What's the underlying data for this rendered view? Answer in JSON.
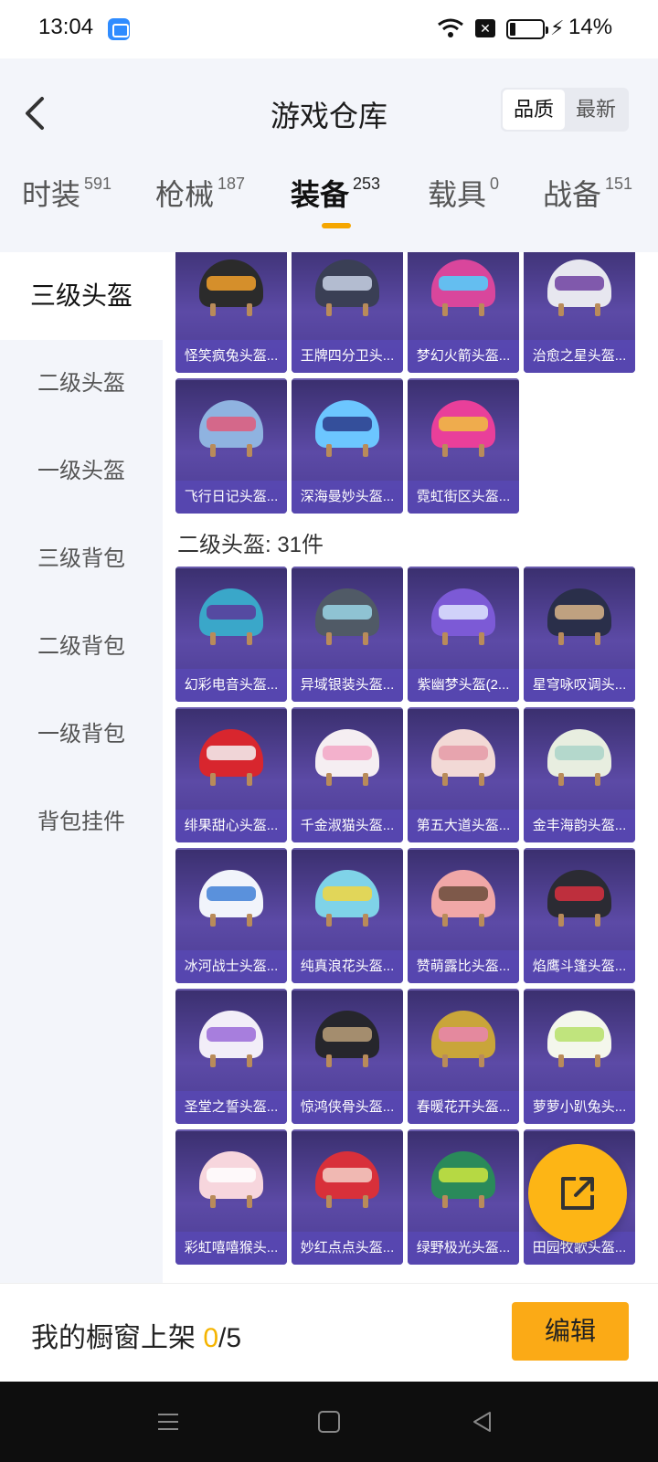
{
  "status_bar": {
    "time": "13:04",
    "battery": "14%"
  },
  "header": {
    "title": "游戏仓库",
    "sort_options": [
      "品质",
      "最新"
    ],
    "sort_active": "品质"
  },
  "categories": [
    {
      "label": "时装",
      "count": "591"
    },
    {
      "label": "枪械",
      "count": "187"
    },
    {
      "label": "装备",
      "count": "253"
    },
    {
      "label": "载具",
      "count": "0"
    },
    {
      "label": "战备",
      "count": "151"
    }
  ],
  "sidebar": [
    "三级头盔",
    "二级头盔",
    "一级头盔",
    "三级背包",
    "二级背包",
    "一级背包",
    "背包挂件"
  ],
  "level3_items": [
    "怪笑疯兔头盔...",
    "王牌四分卫头...",
    "梦幻火箭头盔...",
    "治愈之星头盔...",
    "飞行日记头盔...",
    "深海曼妙头盔...",
    "霓虹街区头盔..."
  ],
  "section_level2": "二级头盔: 31件",
  "level2_items": [
    "幻彩电音头盔...",
    "异域银装头盔...",
    "紫幽梦头盔(2...",
    "星穹咏叹调头...",
    "绯果甜心头盔...",
    "千金淑猫头盔...",
    "第五大道头盔...",
    "金丰海韵头盔...",
    "冰河战士头盔...",
    "纯真浪花头盔...",
    "赞萌露比头盔...",
    "焰鹰斗篷头盔...",
    "圣堂之誓头盔...",
    "惊鸿侠骨头盔...",
    "春暖花开头盔...",
    "萝萝小趴兔头...",
    "彩虹嘻嘻猴头...",
    "妙红点点头盔...",
    "绿野极光头盔...",
    "田园牧歌头盔..."
  ],
  "bottom_bar": {
    "showcase_label": "我的橱窗上架",
    "showcase_count": "0",
    "showcase_total": "/5",
    "edit_label": "编辑"
  },
  "colors": {
    "accent": "#fbaa16",
    "card_bg": "#4a3c92"
  }
}
